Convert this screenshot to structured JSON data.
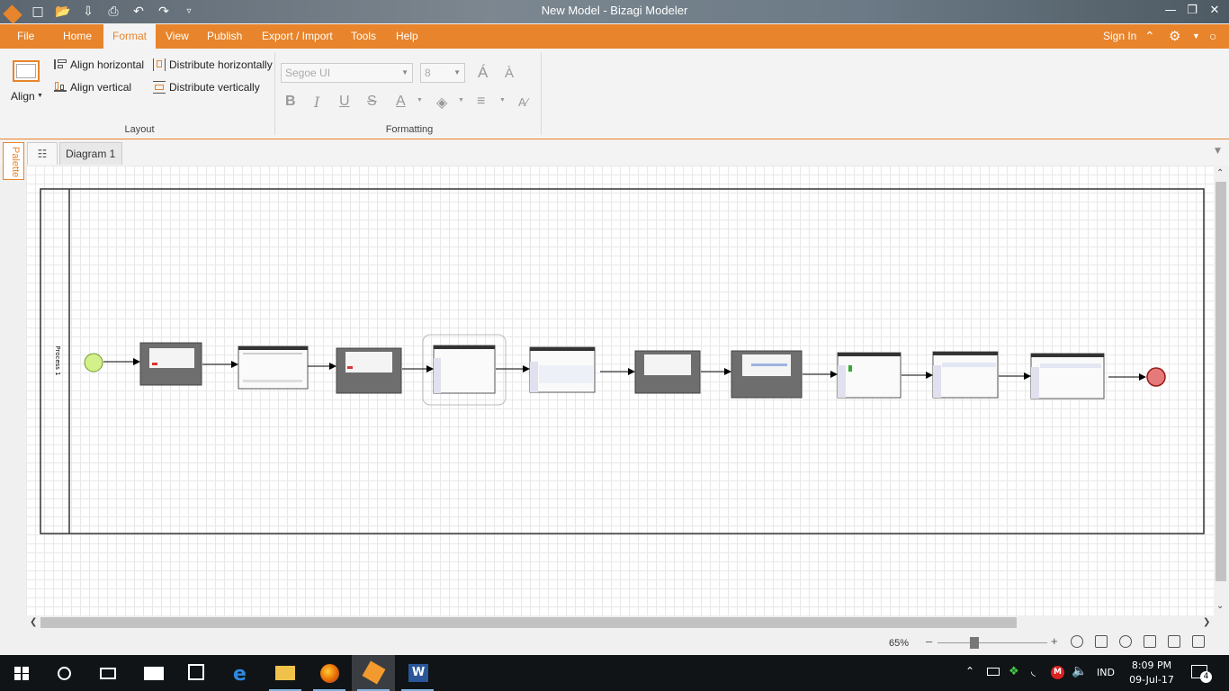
{
  "window": {
    "title": "New Model - Bizagi Modeler",
    "controls": [
      "minimize",
      "restore",
      "close"
    ]
  },
  "quick_access": [
    "app-logo-icon",
    "new-icon",
    "open-icon",
    "save-icon",
    "print-icon",
    "undo-icon",
    "redo-icon",
    "customize-icon"
  ],
  "menu": {
    "items": [
      {
        "label": "File",
        "active": false
      },
      {
        "label": "Home",
        "active": false
      },
      {
        "label": "Format",
        "active": true
      },
      {
        "label": "View",
        "active": false
      },
      {
        "label": "Publish",
        "active": false
      },
      {
        "label": "Export / Import",
        "active": false
      },
      {
        "label": "Tools",
        "active": false
      },
      {
        "label": "Help",
        "active": false
      }
    ],
    "sign_in": "Sign In"
  },
  "ribbon": {
    "layout": {
      "align_label": "Align",
      "align_horizontal": "Align horizontal",
      "align_vertical": "Align vertical",
      "distribute_horizontally": "Distribute horizontally",
      "distribute_vertically": "Distribute vertically",
      "group_label": "Layout"
    },
    "formatting": {
      "font_family": "Segoe UI",
      "font_size": "8",
      "group_label": "Formatting"
    }
  },
  "tabs": {
    "palette": "Palette",
    "diagram": "Diagram 1"
  },
  "diagram": {
    "pool_label": "Process 1",
    "tasks_count_label": "",
    "colors": {
      "start_event": "#d4f08a",
      "end_event": "#e67a7a"
    }
  },
  "status": {
    "zoom": "65%"
  },
  "taskbar": {
    "time": "8:09 PM",
    "date": "09-Jul-17",
    "language": "IND",
    "notifications": "4"
  }
}
